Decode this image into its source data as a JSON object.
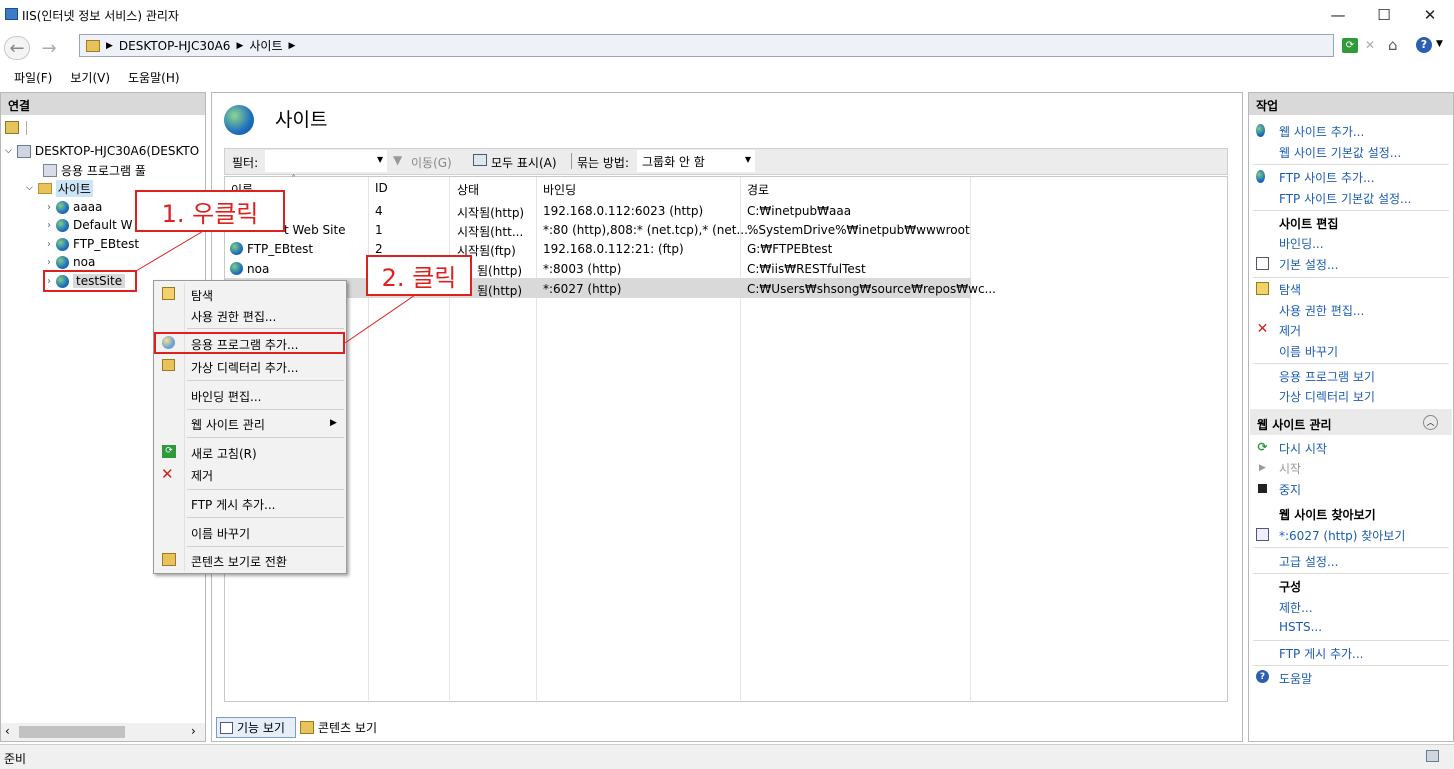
{
  "window": {
    "title": "IIS(인터넷 정보 서비스) 관리자",
    "minimize": "—",
    "maximize": "☐",
    "close": "✕"
  },
  "address": {
    "crumbs": [
      "DESKTOP-HJC30A6",
      "사이트"
    ]
  },
  "menu": [
    "파일(F)",
    "보기(V)",
    "도움말(H)"
  ],
  "left": {
    "header": "연결",
    "tree": {
      "server": "DESKTOP-HJC30A6(DESKTO",
      "app_pools": "응용 프로그램 풀",
      "sites": "사이트",
      "site_items": [
        "aaaa",
        "Default W",
        "FTP_EBtest",
        "noa",
        "testSite"
      ]
    }
  },
  "center": {
    "title": "사이트",
    "toolbar": {
      "filter_label": "필터:",
      "go_label": "이동(G)",
      "show_all_label": "모두 표시(A)",
      "group_by_label": "묶는 방법:",
      "group_by_value": "그룹화 안 함"
    },
    "columns": [
      "이름",
      "ID",
      "상태",
      "바인딩",
      "경로"
    ],
    "rows": [
      {
        "name": "",
        "id": "4",
        "status": "시작됨(http)",
        "binding": "192.168.0.112:6023 (http)",
        "path": "C:₩inetpub₩aaa"
      },
      {
        "name": "t Web Site",
        "id": "1",
        "status": "시작됨(htt...",
        "binding": "*:80 (http),808:* (net.tcp),* (net....",
        "path": "%SystemDrive%₩inetpub₩wwwroot"
      },
      {
        "name": "FTP_EBtest",
        "id": "2",
        "status": "시작됨(ftp)",
        "binding": "192.168.0.112:21: (ftp)",
        "path": "G:₩FTPEBtest"
      },
      {
        "name": "noa",
        "id": "",
        "status": "됨(http)",
        "binding": "*:8003 (http)",
        "path": "C:₩iis₩RESTfulTest"
      },
      {
        "name": "",
        "id": "",
        "status": "됨(http)",
        "binding": "*:6027 (http)",
        "path": "C:₩Users₩shsong₩source₩repos₩wc..."
      }
    ],
    "bottom_tabs": [
      "기능 보기",
      "콘텐츠 보기"
    ]
  },
  "context_menu": {
    "items": [
      "탐색",
      "사용 권한 편집...",
      "응용 프로그램 추가...",
      "가상 디렉터리 추가...",
      "바인딩 편집...",
      "웹 사이트 관리",
      "새로 고침(R)",
      "제거",
      "FTP 게시 추가...",
      "이름 바꾸기",
      "콘텐츠 보기로 전환"
    ]
  },
  "callouts": {
    "step1": "1. 우클릭",
    "step2": "2. 클릭"
  },
  "right": {
    "header": "작업",
    "add_site": "웹 사이트 추가...",
    "site_defaults": "웹 사이트 기본값 설정...",
    "add_ftp": "FTP 사이트 추가...",
    "ftp_defaults": "FTP 사이트 기본값 설정...",
    "edit_site_header": "사이트 편집",
    "bindings": "바인딩...",
    "basic_settings": "기본 설정...",
    "explore": "탐색",
    "edit_permissions": "사용 권한 편집...",
    "remove": "제거",
    "rename": "이름 바꾸기",
    "view_apps": "응용 프로그램 보기",
    "view_vdirs": "가상 디렉터리 보기",
    "manage_header": "웹 사이트 관리",
    "restart": "다시 시작",
    "start": "시작",
    "stop": "중지",
    "browse_header": "웹 사이트 찾아보기",
    "browse_link": "*:6027 (http) 찾아보기",
    "advanced": "고급 설정...",
    "config_header": "구성",
    "limits": "제한...",
    "hsts": "HSTS...",
    "ftp_publish": "FTP 게시 추가...",
    "help": "도움말"
  },
  "status": {
    "text": "준비"
  }
}
